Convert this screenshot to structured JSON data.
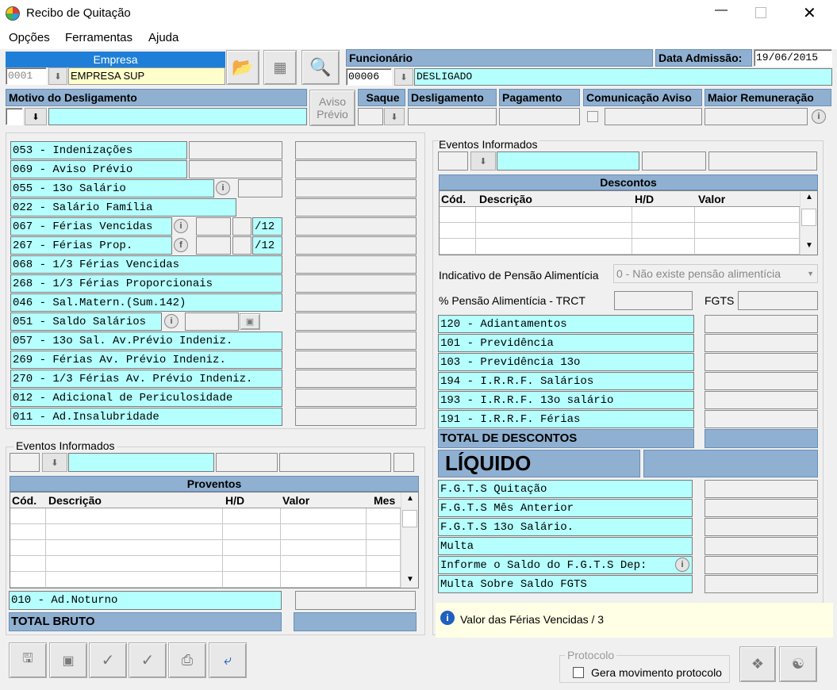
{
  "window": {
    "title": "Recibo de Quitação"
  },
  "menu": [
    "Opções",
    "Ferramentas",
    "Ajuda"
  ],
  "empresa": {
    "header": "Empresa",
    "code": "0001",
    "name": "EMPRESA SUP"
  },
  "funcionario": {
    "header": "Funcionário",
    "code": "00006",
    "name": "DESLIGADO",
    "admissao_label": "Data Admissão:",
    "admissao": "19/06/2015"
  },
  "motivo": {
    "header": "Motivo do Desligamento",
    "aviso_label_1": "Aviso",
    "aviso_label_2": "Prévio"
  },
  "top_headers": {
    "saque": "Saque",
    "desligamento": "Desligamento",
    "pagamento": "Pagamento",
    "comunicacao": "Comunicação Aviso",
    "maior": "Maior Remuneração"
  },
  "proventos_list": [
    {
      "label": "053 - Indenizações"
    },
    {
      "label": "069 - Aviso Prévio"
    },
    {
      "label": "055 - 13o Salário"
    },
    {
      "label": "022 - Salário Família"
    },
    {
      "label": "067 - Férias Vencidas",
      "suffix": "/12"
    },
    {
      "label": "267 - Férias Prop.",
      "suffix": "/12"
    },
    {
      "label": "068 - 1/3 Férias Vencidas"
    },
    {
      "label": "268 - 1/3 Férias Proporcionais"
    },
    {
      "label": "046 - Sal.Matern.(Sum.142)"
    },
    {
      "label": "051 - Saldo Salários"
    },
    {
      "label": "057 - 13o Sal. Av.Prévio Indeniz."
    },
    {
      "label": "269 - Férias  Av. Prévio Indeniz."
    },
    {
      "label": "270 - 1/3 Férias Av. Prévio Indeniz."
    },
    {
      "label": "012 - Adicional de Periculosidade"
    },
    {
      "label": "011 - Ad.Insalubridade"
    }
  ],
  "eventos_left": {
    "title": "Eventos Informados",
    "grid_title": "Proventos",
    "cols": [
      "Cód.",
      "Descrição",
      "H/D",
      "Valor",
      "Mes"
    ]
  },
  "ad_noturno": "010 - Ad.Noturno",
  "total_bruto": "TOTAL BRUTO",
  "eventos_right": {
    "title": "Eventos Informados",
    "grid_title": "Descontos",
    "cols": [
      "Cód.",
      "Descrição",
      "H/D",
      "Valor"
    ]
  },
  "pensao": {
    "label": "Indicativo de Pensão Alimentícia",
    "value": "0 - Não existe pensão alimentícia",
    "pct_label": "% Pensão Alimentícia - TRCT",
    "fgts_label": "FGTS"
  },
  "descontos_list": [
    "120 - Adiantamentos",
    "101 - Previdência",
    "103 - Previdência 13o",
    "194 - I.R.R.F. Salários",
    "193 - I.R.R.F. 13o salário",
    "191 - I.R.R.F. Férias"
  ],
  "total_descontos": "TOTAL DE DESCONTOS",
  "liquido": "LÍQUIDO",
  "fgts_list": [
    "F.G.T.S  Quitação",
    "F.G.T.S  Mês Anterior",
    "F.G.T.S  13o Salário.",
    "Multa",
    "Informe o Saldo do F.G.T.S Dep:",
    "Multa Sobre Saldo FGTS"
  ],
  "info": {
    "text": "Valor das Férias Vencidas / 3"
  },
  "protocolo": {
    "title": "Protocolo",
    "checkbox_label": "Gera movimento protocolo"
  },
  "colors": {
    "cyan": "#b5ffff",
    "header": "#8fb0d1",
    "empresa_header": "#1f7fd8"
  }
}
